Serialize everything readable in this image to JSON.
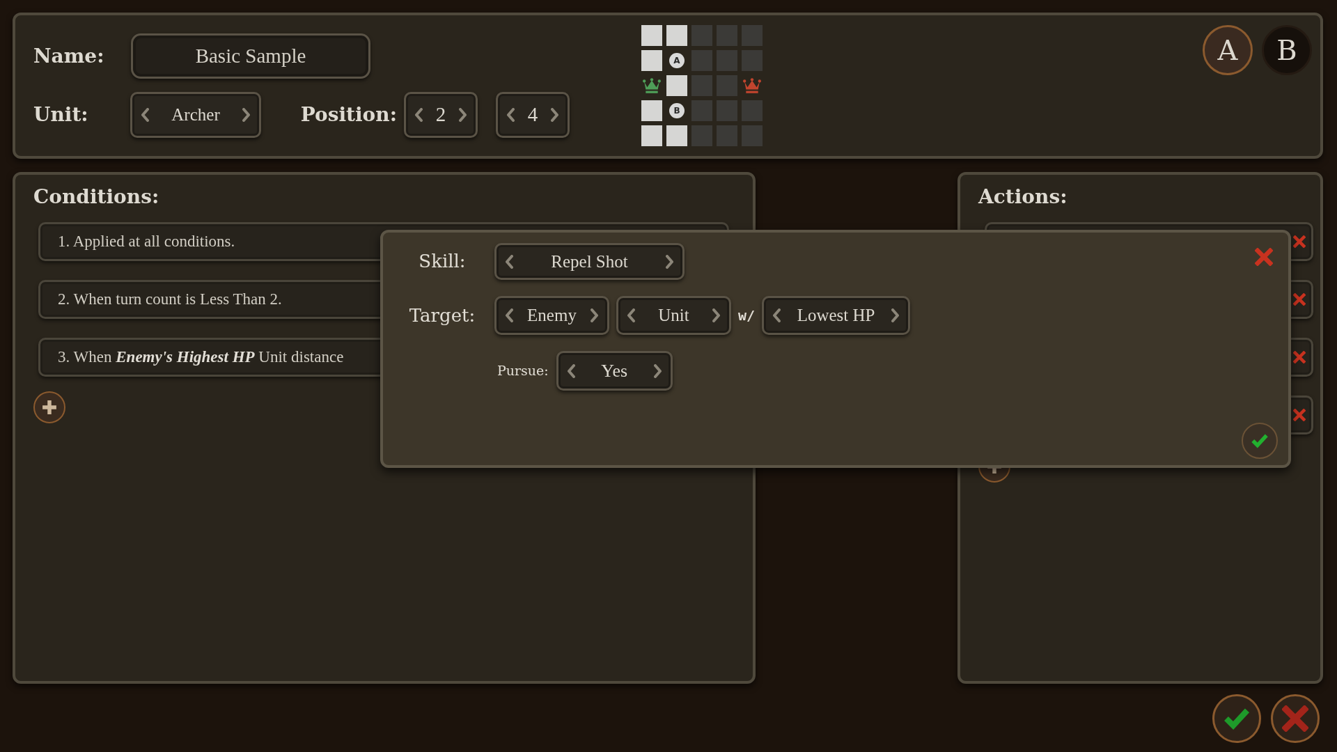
{
  "header": {
    "name": {
      "label": "Name:",
      "value": "Basic Sample"
    },
    "unit": {
      "label": "Unit:",
      "value": "Archer"
    },
    "position": {
      "label": "Position:",
      "values": [
        "2",
        "4"
      ]
    },
    "formation": {
      "rows": [
        [
          {
            "kind": "light"
          },
          {
            "kind": "light"
          },
          {
            "kind": "dark"
          },
          {
            "kind": "dark"
          },
          {
            "kind": "dark"
          }
        ],
        [
          {
            "kind": "light"
          },
          {
            "kind": "marker",
            "label": "A"
          },
          {
            "kind": "dark"
          },
          {
            "kind": "dark"
          },
          {
            "kind": "dark"
          }
        ],
        [
          {
            "kind": "crown",
            "color": "#4e9e58"
          },
          {
            "kind": "light"
          },
          {
            "kind": "dark"
          },
          {
            "kind": "dark"
          },
          {
            "kind": "crown",
            "color": "#c0442e"
          }
        ],
        [
          {
            "kind": "light"
          },
          {
            "kind": "marker",
            "label": "B"
          },
          {
            "kind": "dark"
          },
          {
            "kind": "dark"
          },
          {
            "kind": "dark"
          }
        ],
        [
          {
            "kind": "light"
          },
          {
            "kind": "light"
          },
          {
            "kind": "dark"
          },
          {
            "kind": "dark"
          },
          {
            "kind": "dark"
          }
        ]
      ]
    },
    "sides": [
      {
        "label": "A",
        "selected": true
      },
      {
        "label": "B",
        "selected": false
      }
    ]
  },
  "conditions": {
    "title": "Conditions:",
    "rows": [
      {
        "text": "1. Applied at all conditions."
      },
      {
        "text": "2. When turn count is Less Than 2."
      },
      {
        "text": "3. When **Enemy's Highest HP** Unit distance"
      }
    ]
  },
  "actions": {
    "title": "Actions:",
    "rows": [
      {
        "removable": true
      },
      {
        "removable": true
      },
      {
        "removable": true
      },
      {
        "removable": true
      }
    ]
  },
  "dialog": {
    "skill": {
      "label": "Skill:",
      "value": "Repel Shot"
    },
    "target": {
      "label": "Target:",
      "side": "Enemy",
      "group": "Unit",
      "joiner": "w/",
      "filter": "Lowest HP"
    },
    "pursue": {
      "label": "Pursue:",
      "value": "Yes"
    }
  }
}
